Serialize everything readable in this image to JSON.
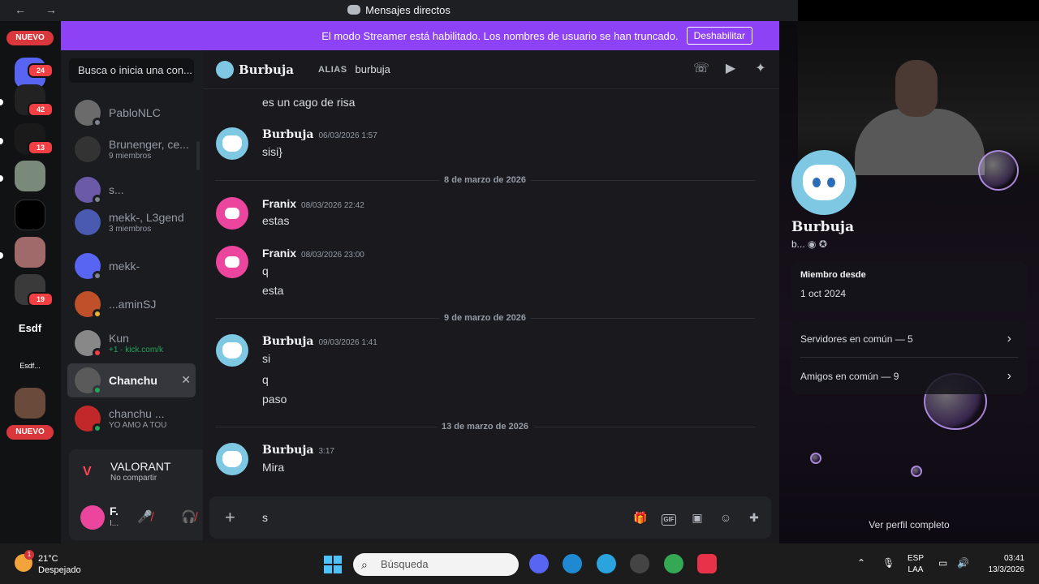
{
  "window": {
    "title": "Mensajes directos",
    "nav_arrows": "← →"
  },
  "banner": {
    "text": "El modo Streamer está habilitado. Los nombres de usuario se han truncado.",
    "button": "Deshabilitar"
  },
  "rail": {
    "new_label": "NUEVO",
    "servers": [
      {
        "badge": "24"
      },
      {
        "badge": "42"
      },
      {
        "badge": "13"
      },
      {
        "badge": ""
      },
      {
        "badge": ""
      },
      {
        "badge": ""
      },
      {
        "badge": "19"
      },
      {
        "label": "Esdf"
      },
      {
        "label": "Esdf..."
      }
    ],
    "new_label_2": "NUEVO"
  },
  "dm_list": {
    "search_placeholder": "Busca o inicia una con...",
    "items": [
      {
        "name": "PabloNLC",
        "sub": ""
      },
      {
        "name": "Brunenger, ce...",
        "sub": "9 miembros"
      },
      {
        "name": "s...",
        "sub": ""
      },
      {
        "name": "mekk-, L3gend",
        "sub": "3 miembros"
      },
      {
        "name": "mekk-",
        "sub": ""
      },
      {
        "name": "...aminSJ",
        "sub": ""
      },
      {
        "name": "Kun",
        "sub": "+1 · kick.com/k"
      },
      {
        "name": "Chanchu",
        "sub": ""
      },
      {
        "name": "chanchu ...",
        "sub": "YO AMO A TOU"
      }
    ]
  },
  "activity": {
    "game": "VALORANT",
    "status": "No compartir"
  },
  "user_panel": {
    "name": "F.",
    "status": "I..."
  },
  "chat_header": {
    "name": "Burbuja",
    "alias_label": "ALIAS",
    "alias": "burbuja"
  },
  "messages": {
    "m0": {
      "text": "es un cago de risa"
    },
    "m1": {
      "author": "Burbuja",
      "time": "06/03/2026 1:57",
      "lines": [
        "sisi}"
      ]
    },
    "d1": "8 de marzo de 2026",
    "m2": {
      "author": "Franix",
      "time": "08/03/2026 22:42",
      "lines": [
        "estas"
      ]
    },
    "m3": {
      "author": "Franix",
      "time": "08/03/2026 23:00",
      "lines": [
        "q",
        "esta"
      ]
    },
    "d2": "9 de marzo de 2026",
    "m4": {
      "author": "Burbuja",
      "time": "09/03/2026 1:41",
      "lines": [
        "si",
        "q",
        "paso"
      ]
    },
    "d3": "13 de marzo de 2026",
    "m5": {
      "author": "Burbuja",
      "time": "3:17",
      "lines": [
        "Mira"
      ]
    }
  },
  "composer": {
    "value": "s"
  },
  "profile": {
    "name": "Burbuja",
    "username": "b...",
    "member_since_label": "Miembro desde",
    "member_since": "1 oct 2024",
    "servers_common": "Servidores en común — 5",
    "friends_common": "Amigos en común — 9",
    "full_profile": "Ver perfil completo"
  },
  "taskbar": {
    "temp": "21°C",
    "weather": "Despejado",
    "weather_badge": "1",
    "search": "Búsqueda",
    "lang1": "ESP",
    "lang2": "LAA",
    "time": "03:41",
    "date": "13/3/2026"
  },
  "colors": {
    "accent": "#5865f2",
    "banner": "#8d42f5",
    "danger": "#f23f43",
    "online": "#23a55a"
  }
}
